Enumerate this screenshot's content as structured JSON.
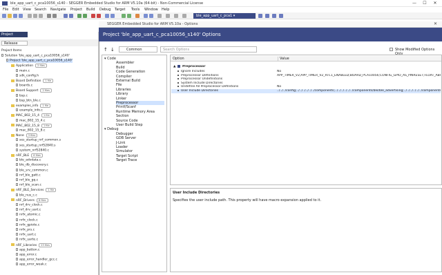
{
  "window": {
    "title": "ble_app_uart_c_pca10056_s140 - SEGGER Embedded Studio for ARM V5.10a (64-bit) - Non-Commercial License",
    "min_glyph": "—",
    "max_glyph": "☐",
    "close_glyph": "✕"
  },
  "menu": [
    "File",
    "Edit",
    "View",
    "Search",
    "Navigate",
    "Project",
    "Build",
    "Debug",
    "Target",
    "Tools",
    "Window",
    "Help"
  ],
  "toolbar": {
    "project_combo": "ble_app_uart_c_pca1 ▾"
  },
  "left_pane": {
    "title": "Project Explorer",
    "config": "Release",
    "section": "Project Items",
    "items": [
      {
        "label": "Solution 'ble_app_uart_c_pca10056_s140'",
        "kind": "file",
        "count": "",
        "sel": false,
        "indent": 0
      },
      {
        "label": "Project 'ble_app_uart_c_pca10056_s140'",
        "kind": "file",
        "count": "",
        "sel": true,
        "indent": 1
      },
      {
        "label": "Application",
        "kind": "folder",
        "count": "2 files",
        "sel": false,
        "indent": 2
      },
      {
        "label": "main.c",
        "kind": "file",
        "count": "",
        "sel": false,
        "indent": 3
      },
      {
        "label": "sdk_config.h",
        "kind": "file",
        "count": "",
        "sel": false,
        "indent": 3
      },
      {
        "label": "Board Definition",
        "kind": "folder",
        "count": "1 file",
        "sel": false,
        "indent": 2
      },
      {
        "label": "boards.c",
        "kind": "file",
        "count": "",
        "sel": false,
        "indent": 3
      },
      {
        "label": "Board Support",
        "kind": "folder",
        "count": "2 files",
        "sel": false,
        "indent": 2
      },
      {
        "label": "bsp.c",
        "kind": "file",
        "count": "",
        "sel": false,
        "indent": 3
      },
      {
        "label": "bsp_btn_ble.c",
        "kind": "file",
        "count": "",
        "sel": false,
        "indent": 3
      },
      {
        "label": "examples_info",
        "kind": "folder",
        "count": "1 file",
        "sel": false,
        "indent": 2
      },
      {
        "label": "example_info.c",
        "kind": "file",
        "count": "",
        "sel": false,
        "indent": 3
      },
      {
        "label": "MAC_802_15_4",
        "kind": "folder",
        "count": "1 file",
        "sel": false,
        "indent": 2
      },
      {
        "label": "mac_802_15_4.c",
        "kind": "file",
        "count": "",
        "sel": false,
        "indent": 3
      },
      {
        "label": "MAC_802_15_8",
        "kind": "folder",
        "count": "1 file",
        "sel": false,
        "indent": 2
      },
      {
        "label": "mac_802_15_8.c",
        "kind": "file",
        "count": "",
        "sel": false,
        "indent": 3
      },
      {
        "label": "None",
        "kind": "folder",
        "count": "3 files",
        "sel": false,
        "indent": 2
      },
      {
        "label": "ses_startup_nrf_common.s",
        "kind": "file",
        "count": "",
        "sel": false,
        "indent": 3
      },
      {
        "label": "ses_startup_nrf52840.s",
        "kind": "file",
        "count": "",
        "sel": false,
        "indent": 3
      },
      {
        "label": "system_nrf52840.c",
        "kind": "file",
        "count": "",
        "sel": false,
        "indent": 3
      },
      {
        "label": "nRF_BLE",
        "kind": "folder",
        "count": "6 files",
        "sel": false,
        "indent": 2
      },
      {
        "label": "ble_advdata.c",
        "kind": "file",
        "count": "",
        "sel": false,
        "indent": 3
      },
      {
        "label": "ble_db_discovery.c",
        "kind": "file",
        "count": "",
        "sel": false,
        "indent": 3
      },
      {
        "label": "ble_srv_common.c",
        "kind": "file",
        "count": "",
        "sel": false,
        "indent": 3
      },
      {
        "label": "nrf_ble_gatt.c",
        "kind": "file",
        "count": "",
        "sel": false,
        "indent": 3
      },
      {
        "label": "nrf_ble_gq.c",
        "kind": "file",
        "count": "",
        "sel": false,
        "indent": 3
      },
      {
        "label": "nrf_ble_scan.c",
        "kind": "file",
        "count": "",
        "sel": false,
        "indent": 3
      },
      {
        "label": "nRF_BLE_Services",
        "kind": "folder",
        "count": "1 file",
        "sel": false,
        "indent": 2
      },
      {
        "label": "ble_nus_c.c",
        "kind": "file",
        "count": "",
        "sel": false,
        "indent": 3
      },
      {
        "label": "nRF_Drivers",
        "kind": "folder",
        "count": "8 files",
        "sel": false,
        "indent": 2
      },
      {
        "label": "nrf_drv_clock.c",
        "kind": "file",
        "count": "",
        "sel": false,
        "indent": 3
      },
      {
        "label": "nrf_drv_uart.c",
        "kind": "file",
        "count": "",
        "sel": false,
        "indent": 3
      },
      {
        "label": "nrfx_atomic.c",
        "kind": "file",
        "count": "",
        "sel": false,
        "indent": 3
      },
      {
        "label": "nrfx_clock.c",
        "kind": "file",
        "count": "",
        "sel": false,
        "indent": 3
      },
      {
        "label": "nrfx_gpiote.c",
        "kind": "file",
        "count": "",
        "sel": false,
        "indent": 3
      },
      {
        "label": "nrfx_prs.c",
        "kind": "file",
        "count": "",
        "sel": false,
        "indent": 3
      },
      {
        "label": "nrfx_uart.c",
        "kind": "file",
        "count": "",
        "sel": false,
        "indent": 3
      },
      {
        "label": "nrfx_uarte.c",
        "kind": "file",
        "count": "",
        "sel": false,
        "indent": 3
      },
      {
        "label": "nRF_Libraries",
        "kind": "folder",
        "count": "23 files",
        "sel": false,
        "indent": 2
      },
      {
        "label": "app_button.c",
        "kind": "file",
        "count": "",
        "sel": false,
        "indent": 3
      },
      {
        "label": "app_error.c",
        "kind": "file",
        "count": "",
        "sel": false,
        "indent": 3
      },
      {
        "label": "app_error_handler_gcc.c",
        "kind": "file",
        "count": "",
        "sel": false,
        "indent": 3
      },
      {
        "label": "app_error_weak.c",
        "kind": "file",
        "count": "",
        "sel": false,
        "indent": 3
      }
    ]
  },
  "dialog": {
    "window_title": "SEGGER Embedded Studio for ARM V5.10a - Options",
    "heading": "Project 'ble_app_uart_c_pca10056_s140' Options",
    "scope": "Common",
    "search_placeholder": "Search Options",
    "show_modified": "Show Modified Options Only",
    "categories": [
      {
        "label": "Code",
        "kind": "group"
      },
      {
        "label": "Assembler",
        "kind": "item"
      },
      {
        "label": "Build",
        "kind": "item"
      },
      {
        "label": "Code Generation",
        "kind": "item"
      },
      {
        "label": "Compiler",
        "kind": "item"
      },
      {
        "label": "External Build",
        "kind": "item"
      },
      {
        "label": "File",
        "kind": "item"
      },
      {
        "label": "Libraries",
        "kind": "item"
      },
      {
        "label": "Library",
        "kind": "item"
      },
      {
        "label": "Linker",
        "kind": "item"
      },
      {
        "label": "Preprocessor",
        "kind": "sel"
      },
      {
        "label": "Printf/Scanf",
        "kind": "item"
      },
      {
        "label": "Runtime Memory Area",
        "kind": "item"
      },
      {
        "label": "Section",
        "kind": "item"
      },
      {
        "label": "Source Code",
        "kind": "item"
      },
      {
        "label": "User Build Step",
        "kind": "item"
      },
      {
        "label": "Debug",
        "kind": "group"
      },
      {
        "label": "Debugger",
        "kind": "item"
      },
      {
        "label": "GDB Server",
        "kind": "item"
      },
      {
        "label": "J-Link",
        "kind": "item"
      },
      {
        "label": "Loader",
        "kind": "item"
      },
      {
        "label": "Simulator",
        "kind": "item"
      },
      {
        "label": "Target Script",
        "kind": "item"
      },
      {
        "label": "Target Trace",
        "kind": "item"
      }
    ],
    "grid_headers": {
      "option": "Option",
      "value": "Value"
    },
    "group": "Preprocessor",
    "rows": [
      {
        "name": "Ignore Includes",
        "value": "No",
        "sel": false
      },
      {
        "name": "Preprocessor Definitions",
        "value": "APP_TIMER_V2;APP_TIMER_V2_RTC1_ENABLED;BOARD_PCA10056;CONFIG_GPIO_AS_PINRESET;FLOAT_ABI_HARD;",
        "sel": false
      },
      {
        "name": "Preprocessor Undefinitions",
        "value": "",
        "sel": false
      },
      {
        "name": "System Include Directories",
        "value": "",
        "sel": false
      },
      {
        "name": "Undefine All Preprocessor Definitions",
        "value": "No",
        "sel": false
      },
      {
        "name": "User Include Directories",
        "value": "../../../config;../../../../../../components;../../../../../../components/ble/ble_advertising;../../../../../../components/",
        "sel": true
      }
    ],
    "help_title": "User Include Directories",
    "help_text": "Specifies the user include path. This property will have macro expansion applied to it."
  }
}
